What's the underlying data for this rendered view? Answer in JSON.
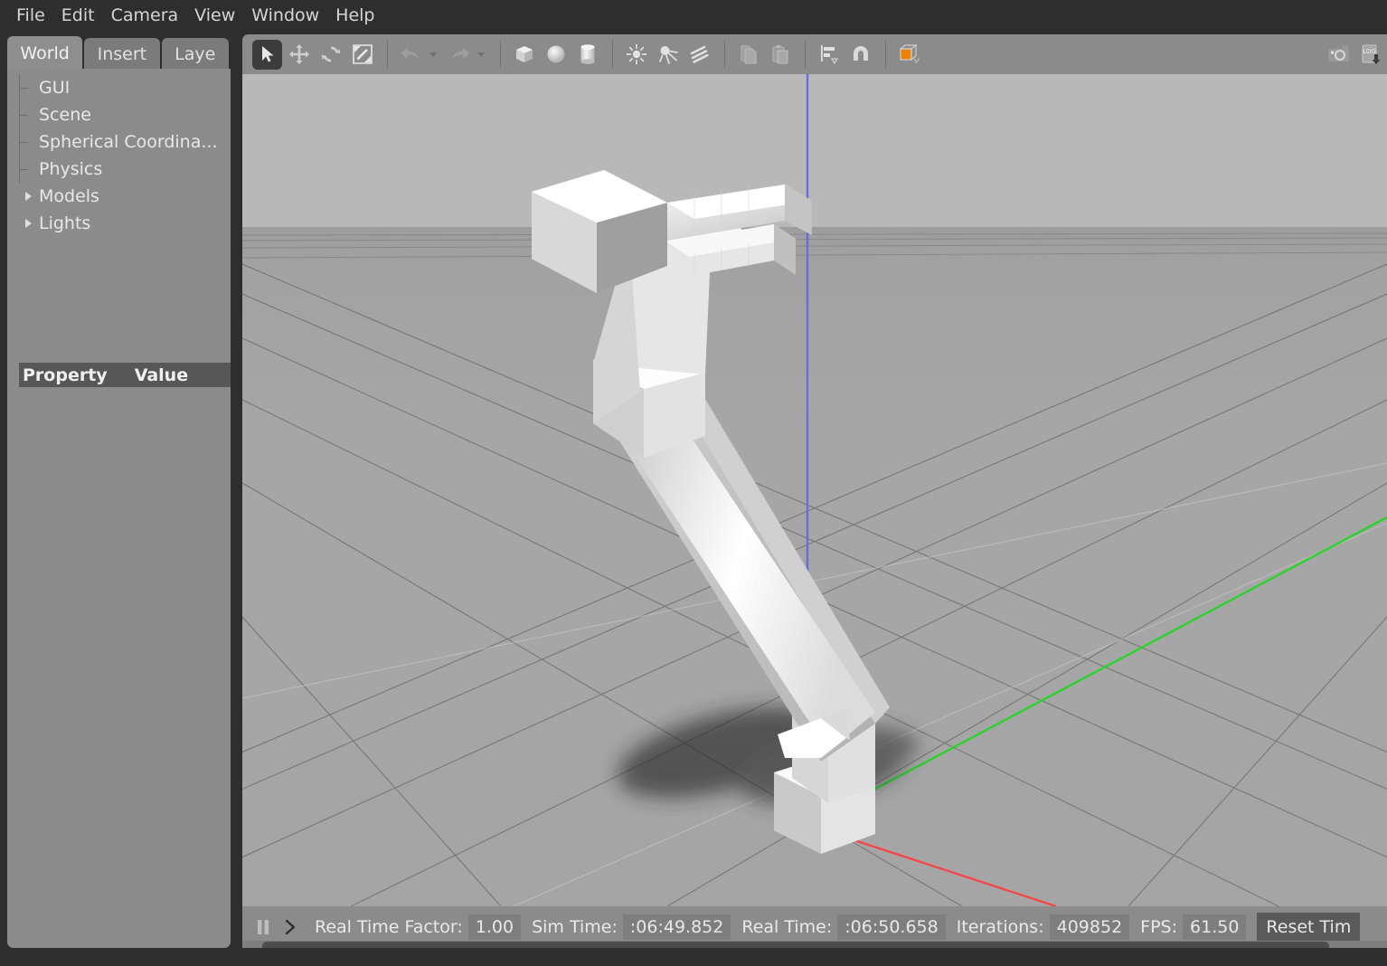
{
  "menubar": {
    "items": [
      {
        "label": "File"
      },
      {
        "label": "Edit"
      },
      {
        "label": "Camera"
      },
      {
        "label": "View"
      },
      {
        "label": "Window"
      },
      {
        "label": "Help"
      }
    ]
  },
  "left_panel": {
    "tabs": [
      {
        "label": "World",
        "active": true
      },
      {
        "label": "Insert",
        "active": false
      },
      {
        "label": "Laye",
        "active": false
      }
    ],
    "tree": [
      {
        "label": "GUI",
        "type": "child"
      },
      {
        "label": "Scene",
        "type": "child"
      },
      {
        "label": "Spherical Coordina...",
        "type": "child"
      },
      {
        "label": "Physics",
        "type": "child"
      },
      {
        "label": "Models",
        "type": "expandable"
      },
      {
        "label": "Lights",
        "type": "expandable"
      }
    ],
    "property_table": {
      "col_property": "Property",
      "col_value": "Value",
      "rows": []
    }
  },
  "toolbar": {
    "groups": [
      {
        "buttons": [
          {
            "name": "select-mode-icon",
            "title": "Selection Mode",
            "active": true
          },
          {
            "name": "translate-mode-icon",
            "title": "Translation Mode",
            "active": false
          },
          {
            "name": "rotate-mode-icon",
            "title": "Rotation Mode",
            "active": false
          },
          {
            "name": "scale-mode-icon",
            "title": "Scale Mode",
            "active": false
          }
        ]
      },
      {
        "buttons": [
          {
            "name": "undo-icon",
            "title": "Undo",
            "active": false
          },
          {
            "name": "redo-icon",
            "title": "Redo",
            "active": false
          }
        ]
      },
      {
        "buttons": [
          {
            "name": "box-icon",
            "title": "Box",
            "active": false
          },
          {
            "name": "sphere-icon",
            "title": "Sphere",
            "active": false
          },
          {
            "name": "cylinder-icon",
            "title": "Cylinder",
            "active": false
          }
        ]
      },
      {
        "buttons": [
          {
            "name": "point-light-icon",
            "title": "Point Light",
            "active": false
          },
          {
            "name": "spot-light-icon",
            "title": "Spot Light",
            "active": false
          },
          {
            "name": "directional-light-icon",
            "title": "Directional Light",
            "active": false
          }
        ]
      },
      {
        "buttons": [
          {
            "name": "copy-icon",
            "title": "Copy",
            "active": false
          },
          {
            "name": "paste-icon",
            "title": "Paste",
            "active": false
          }
        ]
      },
      {
        "buttons": [
          {
            "name": "align-icon",
            "title": "Align",
            "active": false
          },
          {
            "name": "snap-magnet-icon",
            "title": "Snap",
            "active": false
          }
        ]
      },
      {
        "buttons": [
          {
            "name": "view-angle-cube-icon",
            "title": "Change View Angle",
            "active": false
          }
        ]
      }
    ],
    "right_buttons": [
      {
        "name": "screenshot-camera-icon",
        "title": "Take a screenshot"
      },
      {
        "name": "log-download-icon",
        "title": "Log data"
      }
    ],
    "accent_color": "#f08000"
  },
  "viewport": {
    "sky_color": "#b8b8b8",
    "ground_color": "#a5a5a5",
    "grid_color": "#6e6e6e",
    "axis_x_color": "#ff4040",
    "axis_y_color": "#21d821",
    "axis_z_color": "#6a6ae8",
    "model_name": "robot-arm-model",
    "model_color": "#e8e8e8",
    "shadow_color": "#2a2a2a"
  },
  "statusbar": {
    "pause_button": "pause-icon",
    "step_button": "step-forward-icon",
    "real_time_factor": {
      "label": "Real Time Factor:",
      "value": "1.00"
    },
    "sim_time": {
      "label": "Sim Time:",
      "value": ":06:49.852"
    },
    "real_time": {
      "label": "Real Time:",
      "value": ":06:50.658"
    },
    "iterations": {
      "label": "Iterations:",
      "value": "409852"
    },
    "fps": {
      "label": "FPS:",
      "value": "61.50"
    },
    "reset_button": "Reset Tim"
  }
}
